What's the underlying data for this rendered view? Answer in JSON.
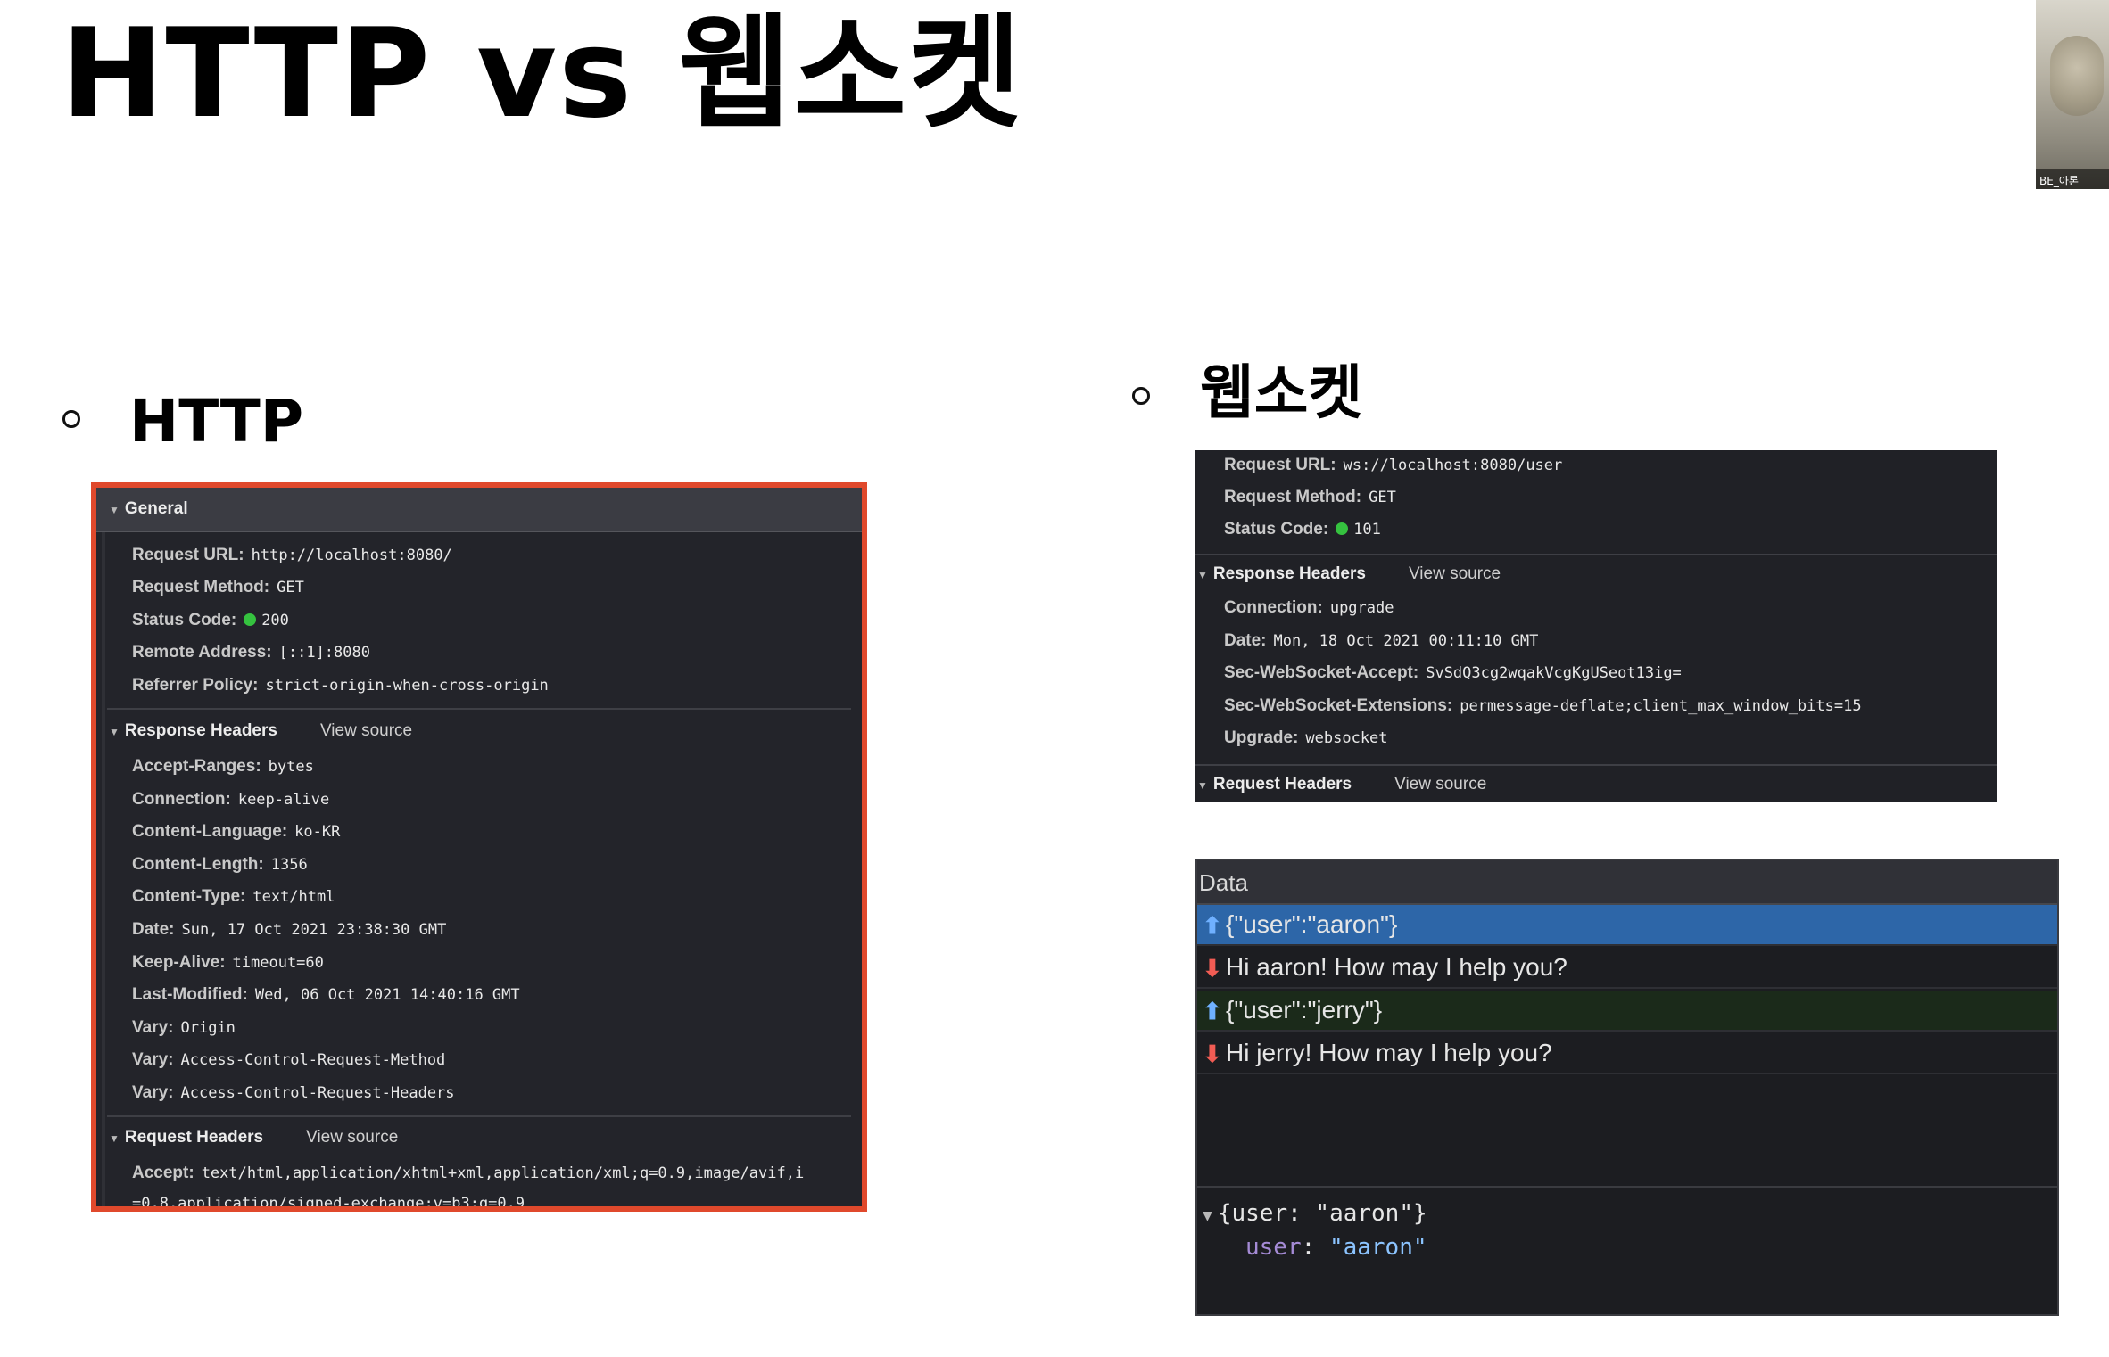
{
  "slide": {
    "title": "HTTP vs 웹소켓",
    "http_label": "HTTP",
    "ws_label": "웹소켓"
  },
  "webcam": {
    "name": "BE_아론"
  },
  "http_panel": {
    "general": "General",
    "request_url_key": "Request URL:",
    "request_url_val": "http://localhost:8080/",
    "request_method_key": "Request Method:",
    "request_method_val": "GET",
    "status_code_key": "Status Code:",
    "status_code_val": "200",
    "remote_address_key": "Remote Address:",
    "remote_address_val": "[::1]:8080",
    "referrer_policy_key": "Referrer Policy:",
    "referrer_policy_val": "strict-origin-when-cross-origin",
    "response_headers": "Response Headers",
    "view_source": "View source",
    "response_headers_rows": [
      {
        "key": "Accept-Ranges:",
        "val": "bytes"
      },
      {
        "key": "Connection:",
        "val": "keep-alive"
      },
      {
        "key": "Content-Language:",
        "val": "ko-KR"
      },
      {
        "key": "Content-Length:",
        "val": "1356"
      },
      {
        "key": "Content-Type:",
        "val": "text/html"
      },
      {
        "key": "Date:",
        "val": "Sun, 17 Oct 2021 23:38:30 GMT"
      },
      {
        "key": "Keep-Alive:",
        "val": "timeout=60"
      },
      {
        "key": "Last-Modified:",
        "val": "Wed, 06 Oct 2021 14:40:16 GMT"
      },
      {
        "key": "Vary:",
        "val": "Origin"
      },
      {
        "key": "Vary:",
        "val": "Access-Control-Request-Method"
      },
      {
        "key": "Vary:",
        "val": "Access-Control-Request-Headers"
      }
    ],
    "request_headers": "Request Headers",
    "accept_key": "Accept:",
    "accept_val": "text/html,application/xhtml+xml,application/xml;q=0.9,image/avif,i",
    "accept_cont": "=0.8,application/signed-exchange;v=b3;q=0.9"
  },
  "ws_headers": {
    "request_url_key": "Request URL:",
    "request_url_val": "ws://localhost:8080/user",
    "request_method_key": "Request Method:",
    "request_method_val": "GET",
    "status_code_key": "Status Code:",
    "status_code_val": "101",
    "response_headers": "Response Headers",
    "view_source": "View source",
    "rows": [
      {
        "key": "Connection:",
        "val": "upgrade"
      },
      {
        "key": "Date:",
        "val": "Mon, 18 Oct 2021 00:11:10 GMT"
      },
      {
        "key": "Sec-WebSocket-Accept:",
        "val": "SvSdQ3cg2wqakVcgKgUSeot13ig="
      },
      {
        "key": "Sec-WebSocket-Extensions:",
        "val": "permessage-deflate;client_max_window_bits=15"
      },
      {
        "key": "Upgrade:",
        "val": "websocket"
      }
    ],
    "request_headers": "Request Headers"
  },
  "ws_frames": {
    "header": "Data",
    "messages": [
      {
        "text": "{\"user\":\"aaron\"}",
        "dir": "up"
      },
      {
        "text": "Hi aaron! How may I help you?",
        "dir": "down"
      },
      {
        "text": "{\"user\":\"jerry\"}",
        "dir": "up"
      },
      {
        "text": "Hi jerry! How may I help you?",
        "dir": "down"
      }
    ],
    "detail_object": "{user: \"aaron\"}",
    "detail_key": "user",
    "detail_val": "\"aaron\""
  },
  "colors": {
    "http_frame_border": "#e0492c",
    "selected_row": "#2d66a8",
    "status_green": "#35c23f",
    "up_arrow": "#6fb0ff",
    "down_arrow": "#f25c54"
  }
}
